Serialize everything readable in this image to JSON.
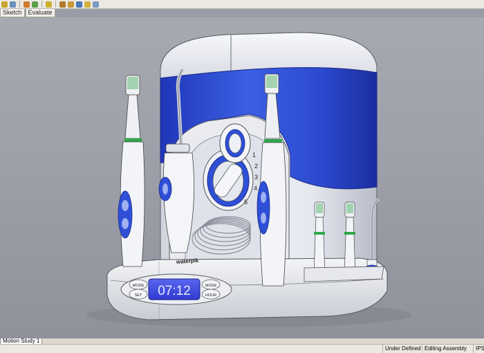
{
  "command_manager": {
    "tabs": [
      {
        "label": "Sketch"
      },
      {
        "label": "Evaluate"
      }
    ]
  },
  "model": {
    "brand_label": "waterpik",
    "pressure_marks": [
      "1",
      "2",
      "3",
      "4",
      "5"
    ],
    "lcd_time": "07:12",
    "panel_buttons": {
      "mode_left": "MODE",
      "set_left": "SET",
      "mode_right": "MODE",
      "hour_right": "HOUR"
    }
  },
  "motion_tab": {
    "label": "Motion Study 1"
  },
  "status": {
    "definition": "Under Defined",
    "editing": "Editing Assembly",
    "units": "IPS"
  },
  "colors": {
    "accent_blue": "#2f4fd3",
    "lcd_blue": "#3a46e0",
    "ui_bg": "#ece9e2",
    "viewport_bg": "#9ea0a9"
  }
}
